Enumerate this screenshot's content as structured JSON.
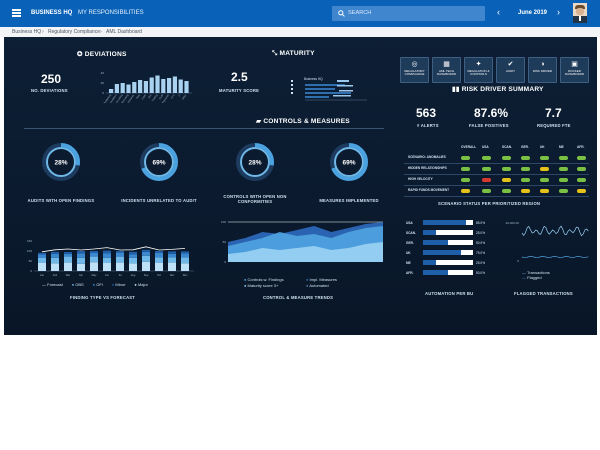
{
  "topbar": {
    "menu_icon": "hamburger-menu-icon",
    "brand": "BUSINESS HQ",
    "nav_item": "MY RESPONSIBILITIES",
    "search_placeholder": "SEARCH",
    "month": "June 2019",
    "prev_icon": "chevron-left-icon",
    "next_icon": "chevron-right-icon"
  },
  "breadcrumb": [
    "Business HQ",
    "Regulatory Compliance",
    "AML Dashboard"
  ],
  "deviations": {
    "title": "DEVIATIONS",
    "value": "250",
    "caption": "NO. DEVIATIONS",
    "axis": [
      "40",
      "20",
      "0"
    ],
    "bars": [
      8,
      18,
      20,
      17,
      22,
      26,
      24,
      31,
      35,
      28,
      30,
      33,
      27,
      24
    ],
    "cats": [
      "Budgeting",
      "Documentation",
      "Accounting",
      "Reporting",
      "Compliance",
      "Risk",
      "Legal",
      "Ops",
      "Trading",
      "Audit",
      "Payments",
      "KYC",
      "IT",
      "Other"
    ]
  },
  "maturity": {
    "title": "MATURITY",
    "value": "2.5",
    "caption": "MATURITY SCORE",
    "legend_row": "Business HQ"
  },
  "actions": [
    {
      "icon": "regulatory-compliance-icon",
      "label": "REGULATORY COMPLIANCE"
    },
    {
      "icon": "dashboard-icon",
      "label": "AML TECH DASHBOARD"
    },
    {
      "icon": "regulation-icon",
      "label": "REGULATION & CONTROLS"
    },
    {
      "icon": "audit-icon",
      "label": "AUDIT"
    },
    {
      "icon": "risk-driver-icon",
      "label": "RISK DRIVER"
    },
    {
      "icon": "docked-dashboard-icon",
      "label": "DOCKED DASHBOARD"
    }
  ],
  "risk": {
    "title": "RISK DRIVER SUMMARY",
    "kpis": [
      {
        "value": "563",
        "label": "# ALERTS"
      },
      {
        "value": "87.6%",
        "label": "FALSE POSITIVES"
      },
      {
        "value": "7.7",
        "label": "REQUIRED FTE"
      }
    ],
    "columns": [
      "OVERALL",
      "USA",
      "SCAN.",
      "GER.",
      "UK",
      "ME",
      "AFR."
    ],
    "rows": [
      {
        "label": "SCENARIO: ANOMALIES",
        "status": [
          "g",
          "g",
          "g",
          "g",
          "g",
          "g",
          "g"
        ]
      },
      {
        "label": "HIDDEN RELATIONSHIPS",
        "status": [
          "g",
          "g",
          "g",
          "g",
          "y",
          "g",
          "g"
        ]
      },
      {
        "label": "HIGH VELOCITY",
        "status": [
          "g",
          "r",
          "y",
          "g",
          "g",
          "g",
          "g"
        ]
      },
      {
        "label": "RAPID FUNDS MOVEMENT",
        "status": [
          "y",
          "g",
          "g",
          "y",
          "y",
          "g",
          "y"
        ]
      }
    ],
    "caption": "SCENARIO STATUS PER PRIORITIZED REGION",
    "colors": {
      "g": "#7ac143",
      "y": "#e3c21a",
      "r": "#d63a2f"
    }
  },
  "controls": {
    "title": "CONTROLS & MEASURES"
  },
  "donuts": [
    {
      "value": "28%",
      "label": "AUDITS WITH OPEN FINDINGS",
      "pct": 28
    },
    {
      "value": "69%",
      "label": "INCIDENTS UNRELATED TO AUDIT",
      "pct": 69
    },
    {
      "value": "28%",
      "label": "CONTROLS WITH OPEN NON CONFORMITIES",
      "pct": 28
    },
    {
      "value": "69%",
      "label": "MEASURES IMPLEMENTED",
      "pct": 69
    }
  ],
  "finding": {
    "axis": [
      "150",
      "100",
      "50",
      "0"
    ],
    "cats": [
      "Jan",
      "Feb",
      "Mar",
      "Apr",
      "May",
      "Jun",
      "Jul",
      "Aug",
      "Sep",
      "Oct",
      "Nov",
      "Dec"
    ],
    "legend": [
      "Forecast",
      "OBS",
      "OFI",
      "Minor",
      "Major"
    ],
    "caption": "FINDING TYPE VS FORECAST"
  },
  "trends": {
    "axis": [
      "100",
      "50",
      "0"
    ],
    "legend": [
      "Controls w. Findings",
      "Impl. Measures",
      "Maturity score 3+",
      "Automated"
    ],
    "caption": "CONTROL & MEASURE TRENDS"
  },
  "automation": {
    "caption": "AUTOMATION PER BU",
    "rows": [
      {
        "label": "USA",
        "value": "85.0%",
        "pct": 85
      },
      {
        "label": "SCAN.",
        "value": "25.0%",
        "pct": 25
      },
      {
        "label": "GER.",
        "value": "50.0%",
        "pct": 50
      },
      {
        "label": "UK",
        "value": "75.0%",
        "pct": 75
      },
      {
        "label": "ME",
        "value": "25.0%",
        "pct": 25
      },
      {
        "label": "AFR.",
        "value": "50.0%",
        "pct": 50
      }
    ]
  },
  "flagged": {
    "axis": [
      "20,000.00",
      "0"
    ],
    "legend": [
      "Transactions",
      "Flagged"
    ],
    "caption": "FLAGGED TRANSACTIONS"
  }
}
